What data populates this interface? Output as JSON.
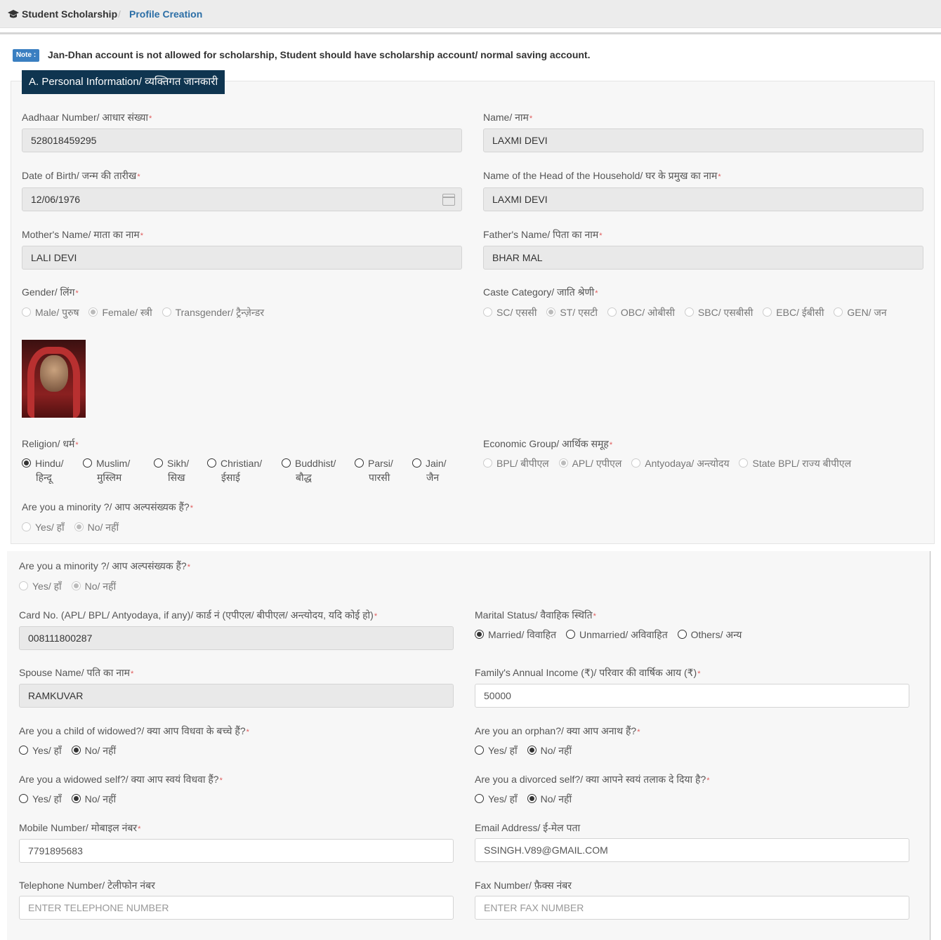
{
  "breadcrumb": {
    "home": "Student Scholarship",
    "separator": "/",
    "current": "Profile Creation"
  },
  "note": {
    "badge": "Note :",
    "text": "Jan-Dhan account is not allowed for scholarship, Student should have scholarship account/ normal saving account."
  },
  "section_a": {
    "title": "A. Personal Information/ व्यक्तिगत जानकारी"
  },
  "fields": {
    "aadhaar": {
      "label": "Aadhaar Number/ आधार संख्या",
      "value": "528018459295"
    },
    "name": {
      "label": "Name/ नाम",
      "value": "LAXMI DEVI"
    },
    "dob": {
      "label": "Date of Birth/ जन्म की तारीख",
      "value": "12/06/1976"
    },
    "head": {
      "label": "Name of the Head of the Household/ घर के प्रमुख का नाम",
      "value": "LAXMI DEVI"
    },
    "mother": {
      "label": "Mother's Name/ माता का नाम",
      "value": "LALI DEVI"
    },
    "father": {
      "label": "Father's Name/ पिता का नाम",
      "value": "BHAR MAL"
    },
    "card": {
      "label": "Card No. (APL/ BPL/ Antyodaya, if any)/ कार्ड नं (एपीएल/ बीपीएल/ अन्त्योदय, यदि कोई हो)",
      "value": "008111800287"
    },
    "spouse": {
      "label": "Spouse Name/ पति का नाम",
      "value": "RAMKUVAR"
    },
    "income": {
      "label": "Family's Annual Income (₹)/ परिवार की वार्षिक आय (₹)",
      "value": "50000"
    },
    "mobile": {
      "label": "Mobile Number/ मोबाइल नंबर",
      "value": "7791895683"
    },
    "email": {
      "label": "Email Address/ ई-मेल पता",
      "value": "SSINGH.V89@GMAIL.COM"
    },
    "telephone": {
      "label": "Telephone Number/ टेलीफोन नंबर",
      "placeholder": "ENTER TELEPHONE NUMBER"
    },
    "fax": {
      "label": "Fax Number/ फ़ैक्स नंबर",
      "placeholder": "ENTER FAX NUMBER"
    }
  },
  "gender": {
    "label": "Gender/ लिंग",
    "options": [
      "Male/ पुरुष",
      "Female/ स्त्री",
      "Transgender/ ट्रैन्ज़ेन्डर"
    ],
    "selected": "Female/ स्त्री"
  },
  "caste": {
    "label": "Caste Category/ जाति श्रेणी",
    "options": [
      "SC/ एससी",
      "ST/ एसटी",
      "OBC/ ओबीसी",
      "SBC/ एसबीसी",
      "EBC/ ईबीसी",
      "GEN/ जन"
    ],
    "selected": "ST/ एसटी"
  },
  "religion": {
    "label": "Religion/ धर्म",
    "options": [
      {
        "line1": "Hindu/",
        "line2": "हिन्दू"
      },
      {
        "line1": "Muslim/",
        "line2": "मुस्लिम"
      },
      {
        "line1": "Sikh/",
        "line2": "सिख"
      },
      {
        "line1": "Christian/",
        "line2": "ईसाई"
      },
      {
        "line1": "Buddhist/",
        "line2": "बौद्ध"
      },
      {
        "line1": "Parsi/",
        "line2": "पारसी"
      },
      {
        "line1": "Jain/",
        "line2": "जैन"
      }
    ],
    "selected": "Hindu/"
  },
  "economic": {
    "label": "Economic Group/ आर्थिक समूह",
    "options": [
      "BPL/ बीपीएल",
      "APL/ एपीएल",
      "Antyodaya/ अन्त्योदय",
      "State BPL/ राज्य बीपीएल"
    ],
    "selected": "APL/ एपीएल"
  },
  "minority": {
    "label": "Are you a minority ?/ आप अल्पसंख्यक हैं?",
    "options": [
      "Yes/ हाँ",
      "No/ नहीं"
    ],
    "selected": "No/ नहीं"
  },
  "marital": {
    "label": "Marital Status/ वैवाहिक स्थिति",
    "options": [
      "Married/ विवाहित",
      "Unmarried/ अविवाहित",
      "Others/ अन्य"
    ],
    "selected": "Married/ विवाहित"
  },
  "widow_child": {
    "label": "Are you a child of widowed?/ क्या आप विधवा के बच्चे हैं?",
    "options": [
      "Yes/ हाँ",
      "No/ नहीं"
    ],
    "selected": "No/ नहीं"
  },
  "orphan": {
    "label": "Are you an orphan?/ क्या आप अनाथ हैं?",
    "options": [
      "Yes/ हाँ",
      "No/ नहीं"
    ],
    "selected": "No/ नहीं"
  },
  "widowed_self": {
    "label": "Are you a widowed self?/ क्या आप स्वयं विधवा हैं?",
    "options": [
      "Yes/ हाँ",
      "No/ नहीं"
    ],
    "selected": "No/ नहीं"
  },
  "divorced_self": {
    "label": "Are you a divorced self?/ क्या आपने स्वयं तलाक दे दिया है?",
    "options": [
      "Yes/ हाँ",
      "No/ नहीं"
    ],
    "selected": "No/ नहीं"
  },
  "required_mark": "*"
}
